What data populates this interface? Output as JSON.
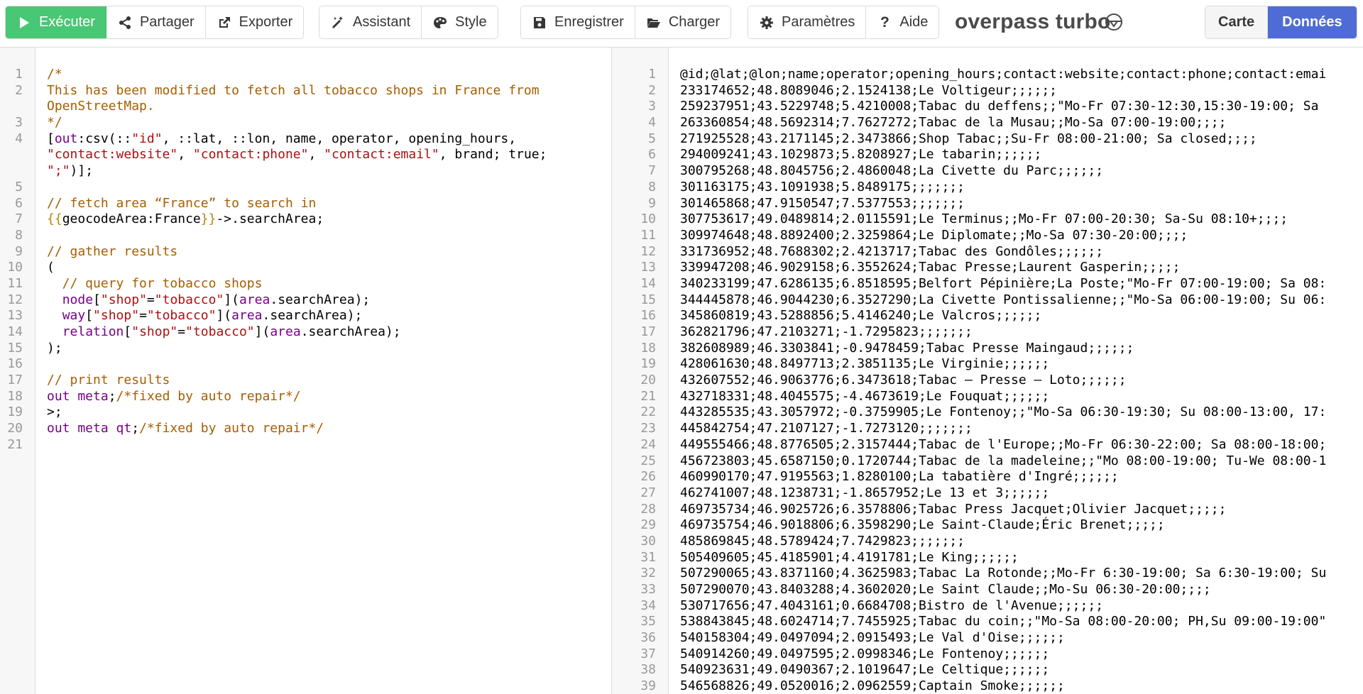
{
  "toolbar": {
    "run_label": "Exécuter",
    "share_label": "Partager",
    "export_label": "Exporter",
    "wizard_label": "Assistant",
    "style_label": "Style",
    "save_label": "Enregistrer",
    "load_label": "Charger",
    "settings_label": "Paramètres",
    "help_label": "Aide",
    "map_label": "Carte",
    "data_label": "Données"
  },
  "app_title": "overpass turbo",
  "colors": {
    "run": "#48c774",
    "active_tab": "#4f6cd6",
    "comment": "#a65e00",
    "string": "#aa1111",
    "keyword": "#770088"
  },
  "editor": {
    "line_numbers": [
      "1",
      "2",
      "",
      "3",
      "4",
      "",
      "",
      "5",
      "6",
      "7",
      "8",
      "9",
      "10",
      "11",
      "12",
      "13",
      "14",
      "15",
      "16",
      "17",
      "18",
      "19",
      "20",
      "21"
    ],
    "lines": [
      [
        {
          "t": "/*",
          "c": "comment"
        }
      ],
      [
        {
          "t": "This has been modified to fetch all tobacco shops in France from",
          "c": "comment"
        }
      ],
      [
        {
          "t": "OpenStreetMap.",
          "c": "comment"
        }
      ],
      [
        {
          "t": "*/",
          "c": "comment"
        }
      ],
      [
        {
          "t": "[",
          "c": "text"
        },
        {
          "t": "out",
          "c": "kw"
        },
        {
          "t": ":csv(::",
          "c": "text"
        },
        {
          "t": "\"id\"",
          "c": "str"
        },
        {
          "t": ", ::lat, ::lon, name, operator, opening_hours,",
          "c": "text"
        }
      ],
      [
        {
          "t": "\"contact:website\"",
          "c": "str"
        },
        {
          "t": ", ",
          "c": "text"
        },
        {
          "t": "\"contact:phone\"",
          "c": "str"
        },
        {
          "t": ", ",
          "c": "text"
        },
        {
          "t": "\"contact:email\"",
          "c": "str"
        },
        {
          "t": ", brand; true;",
          "c": "text"
        }
      ],
      [
        {
          "t": "\";\"",
          "c": "str"
        },
        {
          "t": ")];",
          "c": "text"
        }
      ],
      [
        {
          "t": "",
          "c": "text"
        }
      ],
      [
        {
          "t": "// fetch area “France” to search in",
          "c": "comment"
        }
      ],
      [
        {
          "t": "{{",
          "c": "tpl"
        },
        {
          "t": "geocodeArea:France",
          "c": "text"
        },
        {
          "t": "}}",
          "c": "tpl"
        },
        {
          "t": "->.searchArea;",
          "c": "text"
        }
      ],
      [
        {
          "t": "",
          "c": "text"
        }
      ],
      [
        {
          "t": "// gather results",
          "c": "comment"
        }
      ],
      [
        {
          "t": "(",
          "c": "text"
        }
      ],
      [
        {
          "t": "  // query for tobacco shops",
          "c": "comment"
        }
      ],
      [
        {
          "t": "  ",
          "c": "text"
        },
        {
          "t": "node",
          "c": "kw"
        },
        {
          "t": "[",
          "c": "text"
        },
        {
          "t": "\"shop\"",
          "c": "str"
        },
        {
          "t": "=",
          "c": "text"
        },
        {
          "t": "\"tobacco\"",
          "c": "str"
        },
        {
          "t": "](",
          "c": "text"
        },
        {
          "t": "area",
          "c": "kw"
        },
        {
          "t": ".searchArea);",
          "c": "text"
        }
      ],
      [
        {
          "t": "  ",
          "c": "text"
        },
        {
          "t": "way",
          "c": "kw"
        },
        {
          "t": "[",
          "c": "text"
        },
        {
          "t": "\"shop\"",
          "c": "str"
        },
        {
          "t": "=",
          "c": "text"
        },
        {
          "t": "\"tobacco\"",
          "c": "str"
        },
        {
          "t": "](",
          "c": "text"
        },
        {
          "t": "area",
          "c": "kw"
        },
        {
          "t": ".searchArea);",
          "c": "text"
        }
      ],
      [
        {
          "t": "  ",
          "c": "text"
        },
        {
          "t": "relation",
          "c": "kw"
        },
        {
          "t": "[",
          "c": "text"
        },
        {
          "t": "\"shop\"",
          "c": "str"
        },
        {
          "t": "=",
          "c": "text"
        },
        {
          "t": "\"tobacco\"",
          "c": "str"
        },
        {
          "t": "](",
          "c": "text"
        },
        {
          "t": "area",
          "c": "kw"
        },
        {
          "t": ".searchArea);",
          "c": "text"
        }
      ],
      [
        {
          "t": ");",
          "c": "text"
        }
      ],
      [
        {
          "t": "",
          "c": "text"
        }
      ],
      [
        {
          "t": "// print results",
          "c": "comment"
        }
      ],
      [
        {
          "t": "out meta",
          "c": "kw"
        },
        {
          "t": ";",
          "c": "text"
        },
        {
          "t": "/*fixed by auto repair*/",
          "c": "comment"
        }
      ],
      [
        {
          "t": ">;",
          "c": "text"
        }
      ],
      [
        {
          "t": "out meta qt",
          "c": "kw"
        },
        {
          "t": ";",
          "c": "text"
        },
        {
          "t": "/*fixed by auto repair*/",
          "c": "comment"
        }
      ],
      [
        {
          "t": "",
          "c": "text"
        }
      ]
    ]
  },
  "data_view": {
    "lines": [
      "@id;@lat;@lon;name;operator;opening_hours;contact:website;contact:phone;contact:emai",
      "233174652;48.8089046;2.1524138;Le Voltigeur;;;;;;",
      "259237951;43.5229748;5.4210008;Tabac du deffens;;\"Mo-Fr 07:30-12:30,15:30-19:00; Sa",
      "263360854;48.5692314;7.7627272;Tabac de la Musau;;Mo-Sa 07:00-19:00;;;;",
      "271925528;43.2171145;2.3473866;Shop Tabac;;Su-Fr 08:00-21:00; Sa closed;;;;",
      "294009241;43.1029873;5.8208927;Le tabarin;;;;;;",
      "300795268;48.8045756;2.4860048;La Civette du Parc;;;;;;",
      "301163175;43.1091938;5.8489175;;;;;;;",
      "301465868;47.9150547;7.5377553;;;;;;;",
      "307753617;49.0489814;2.0115591;Le Terminus;;Mo-Fr 07:00-20:30; Sa-Su 08:10+;;;;",
      "309974648;48.8892400;2.3259864;Le Diplomate;;Mo-Sa 07:30-20:00;;;;",
      "331736952;48.7688302;2.4213717;Tabac des Gondôles;;;;;;",
      "339947208;46.9029158;6.3552624;Tabac Presse;Laurent Gasperin;;;;;",
      "340233199;47.6286135;6.8518595;Belfort Pépinière;La Poste;\"Mo-Fr 07:00-19:00; Sa 08:",
      "344445878;46.9044230;6.3527290;La Civette Pontissalienne;;\"Mo-Sa 06:00-19:00; Su 06:",
      "345860819;43.5288856;5.4146240;Le Valcros;;;;;;",
      "362821796;47.2103271;-1.7295823;;;;;;;",
      "382608989;46.3303841;-0.9478459;Tabac Presse Maingaud;;;;;;",
      "428061630;48.8497713;2.3851135;Le Virginie;;;;;;",
      "432607552;46.9063776;6.3473618;Tabac – Presse – Loto;;;;;;",
      "432718331;48.4045575;-4.4673619;Le Fouquat;;;;;;",
      "443285535;43.3057972;-0.3759905;Le Fontenoy;;\"Mo-Sa 06:30-19:30; Su 08:00-13:00, 17:",
      "445842754;47.2107127;-1.7273120;;;;;;;",
      "449555466;48.8776505;2.3157444;Tabac de l'Europe;;Mo-Fr 06:30-22:00; Sa 08:00-18:00;",
      "456723803;45.6587150;0.1720744;Tabac de la madeleine;;\"Mo 08:00-19:00; Tu-We 08:00-1",
      "460990170;47.9195563;1.8280100;La tabatière d'Ingré;;;;;;",
      "462741007;48.1238731;-1.8657952;Le 13 et 3;;;;;;",
      "469735734;46.9025726;6.3578806;Tabac Press Jacquet;Olivier Jacquet;;;;;",
      "469735754;46.9018806;6.3598290;Le Saint-Claude;Éric Brenet;;;;;",
      "485869845;48.5789424;7.7429823;;;;;;;",
      "505409605;45.4185901;4.4191781;Le King;;;;;;",
      "507290065;43.8371160;4.3625983;Tabac La Rotonde;;Mo-Fr 6:30-19:00; Sa 6:30-19:00; Su",
      "507290070;43.8403288;4.3602020;Le Saint Claude;;Mo-Su 06:30-20:00;;;;",
      "530717656;47.4043161;0.6684708;Bistro de l'Avenue;;;;;;",
      "538843845;48.6024714;7.7455925;Tabac du coin;;\"Mo-Sa 08:00-20:00; PH,Su 09:00-19:00\"",
      "540158304;49.0497094;2.0915493;Le Val d'Oise;;;;;;",
      "540914260;49.0497595;2.0998346;Le Fontenoy;;;;;;",
      "540923631;49.0490367;2.1019647;Le Celtique;;;;;;",
      "546568826;49.0520016;2.0962559;Captain Smoke;;;;;;"
    ]
  }
}
